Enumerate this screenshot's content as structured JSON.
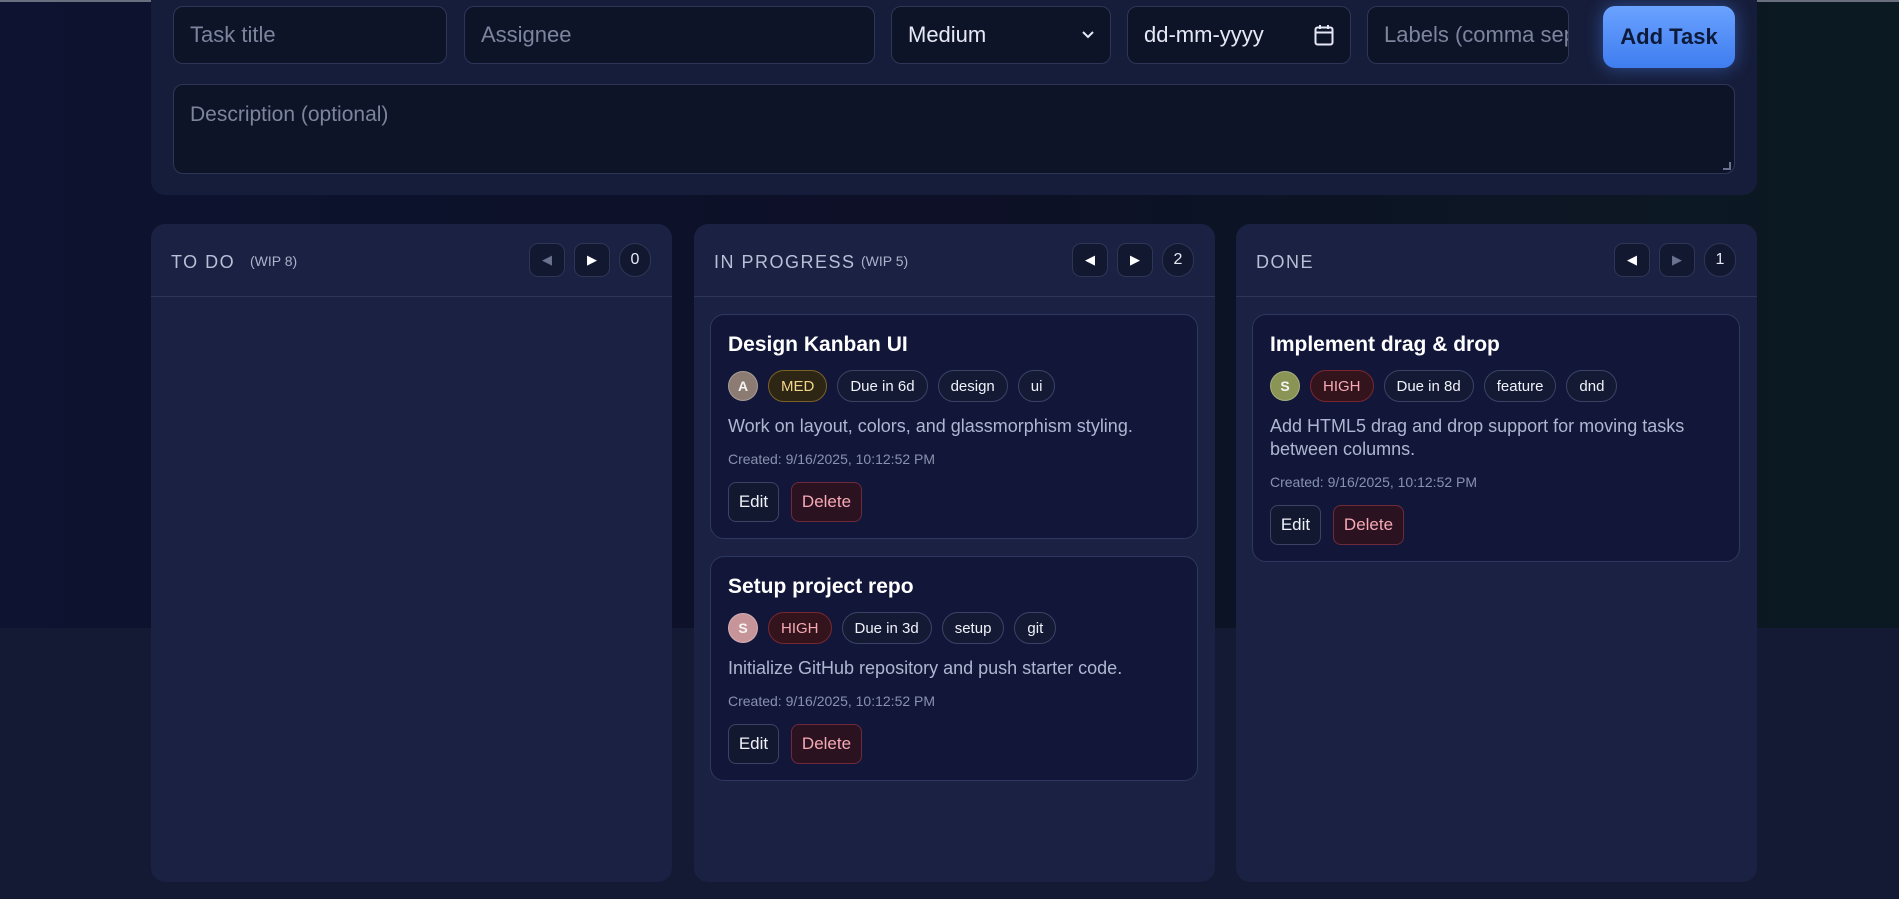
{
  "form": {
    "title_placeholder": "Task title",
    "assignee_placeholder": "Assignee",
    "priority_value": "Medium",
    "date_placeholder": "dd-mm-yyyy",
    "labels_placeholder": "Labels (comma separated)",
    "add_label": "Add Task",
    "description_placeholder": "Description (optional)"
  },
  "columns": [
    {
      "title": "TO DO",
      "wip": "(WIP 8)",
      "count": "0",
      "prev_icon": "triangle-left-icon",
      "next_icon": "triangle-right-icon",
      "cards": []
    },
    {
      "title": "IN PROGRESS",
      "wip": "(WIP 5)",
      "count": "2",
      "prev_icon": "triangle-left-icon",
      "next_icon": "triangle-right-icon",
      "cards": [
        {
          "title": "Design Kanban UI",
          "avatar": "A",
          "avatar_color": "#8c7b72",
          "priority": "MED",
          "due": "Due in 6d",
          "labels": [
            "design",
            "ui"
          ],
          "description": "Work on layout, colors, and glassmorphism styling.",
          "created": "Created: 9/16/2025, 10:12:52 PM",
          "edit": "Edit",
          "delete": "Delete"
        },
        {
          "title": "Setup project repo",
          "avatar": "S",
          "avatar_color": "#c7949a",
          "priority": "HIGH",
          "due": "Due in 3d",
          "labels": [
            "setup",
            "git"
          ],
          "description": "Initialize GitHub repository and push starter code.",
          "created": "Created: 9/16/2025, 10:12:52 PM",
          "edit": "Edit",
          "delete": "Delete"
        }
      ]
    },
    {
      "title": "DONE",
      "wip": "",
      "count": "1",
      "prev_icon": "triangle-left-icon",
      "next_icon": "triangle-right-icon",
      "cards": [
        {
          "title": "Implement drag & drop",
          "avatar": "S",
          "avatar_color": "#8a9454",
          "priority": "HIGH",
          "due": "Due in 8d",
          "labels": [
            "feature",
            "dnd"
          ],
          "description": "Add HTML5 drag and drop support for moving tasks between columns.",
          "created": "Created: 9/16/2025, 10:12:52 PM",
          "edit": "Edit",
          "delete": "Delete"
        }
      ]
    }
  ]
}
